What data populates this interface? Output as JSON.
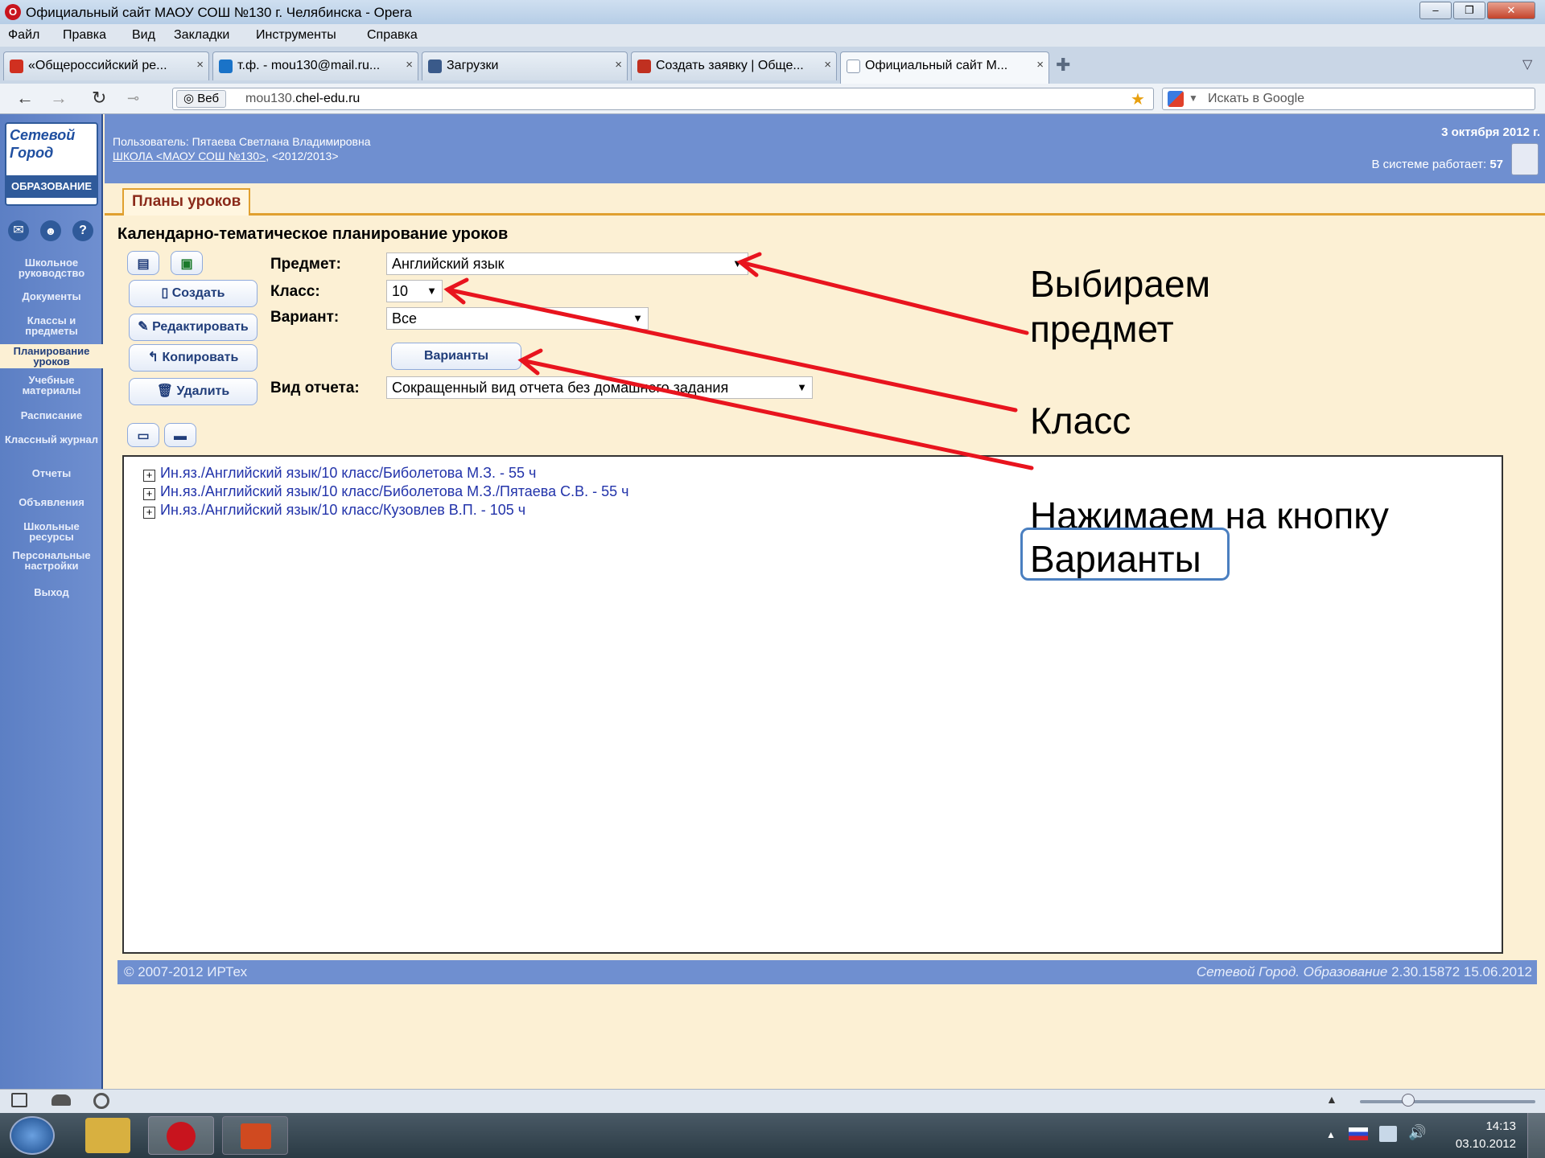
{
  "window": {
    "title": "Официальный сайт МАОУ СОШ №130 г. Челябинска - Opera",
    "min": "–",
    "max": "❐",
    "close": "✕"
  },
  "menu": [
    "Файл",
    "Правка",
    "Вид",
    "Закладки",
    "Инструменты",
    "Справка"
  ],
  "tabs": [
    {
      "label": "«Общероссийский ре...",
      "icon_color": "#d03020"
    },
    {
      "label": "т.ф. - mou130@mail.ru...",
      "icon_color": "#1a73c8"
    },
    {
      "label": "Загрузки",
      "icon_color": "#3a5a8a"
    },
    {
      "label": "Создать заявку | Обще...",
      "icon_color": "#c03020"
    },
    {
      "label": "Официальный сайт М...",
      "icon_color": "#8a9ab0"
    }
  ],
  "address": {
    "web_label": "Веб",
    "url_prefix": "mou130.",
    "url_domain": "chel-edu.ru",
    "search_placeholder": "Искать в Google"
  },
  "logo": {
    "line1": "Сетевой",
    "line2": "Город",
    "line3": "ОБРАЗОВАНИЕ"
  },
  "header": {
    "user": "Пользователь: Пятаева Светлана Владимировна",
    "school": "ШКОЛА <МАОУ СОШ №130>",
    "year": "<2012/2013>",
    "date": "3 октября 2012 г.",
    "online_label": "В системе работает:",
    "online_count": "57"
  },
  "sidebar": [
    {
      "label": "Школьное руководство"
    },
    {
      "label": "Документы"
    },
    {
      "label": "Классы и предметы"
    },
    {
      "label": "Планирование уроков",
      "active": true
    },
    {
      "label": "Учебные материалы"
    },
    {
      "label": "Расписание"
    },
    {
      "label": "Классный журнал"
    },
    {
      "label": "Отчеты"
    },
    {
      "label": "Объявления"
    },
    {
      "label": "Школьные ресурсы"
    },
    {
      "label": "Персональные настройки"
    },
    {
      "label": "Выход"
    }
  ],
  "page": {
    "tab": "Планы уроков",
    "title": "Календарно-тематическое планирование уроков"
  },
  "buttons": {
    "create": "Создать",
    "edit": "Редактировать",
    "copy": "Копировать",
    "delete": "Удалить",
    "variants": "Варианты"
  },
  "form": {
    "subject_label": "Предмет:",
    "subject_value": "Английский язык",
    "class_label": "Класс:",
    "class_value": "10",
    "variant_label": "Вариант:",
    "variant_value": "Все",
    "report_label": "Вид отчета:",
    "report_value": "Сокращенный вид отчета без домашнего задания"
  },
  "plans": [
    "Ин.яз./Английский язык/10 класс/Биболетова М.З. - 55 ч",
    "Ин.яз./Английский язык/10 класс/Биболетова М.З./Пятаева С.В. - 55 ч",
    "Ин.яз./Английский язык/10 класс/Кузовлев В.П. - 105 ч"
  ],
  "footer": {
    "copyright": "© 2007-2012 ИРТех",
    "product": "Сетевой Город. Образование",
    "version": "2.30.15872  15.06.2012"
  },
  "annotations": {
    "choose1": "Выбираем",
    "choose2": "предмет",
    "class": "Класс",
    "press1": "Нажимаем на кнопку",
    "press2": "Варианты"
  },
  "colors": {
    "arrow": "#e8141e",
    "accent_blue": "#6f8fd0",
    "cream": "#fcf0d4"
  },
  "tray": {
    "time": "14:13",
    "date": "03.10.2012"
  }
}
